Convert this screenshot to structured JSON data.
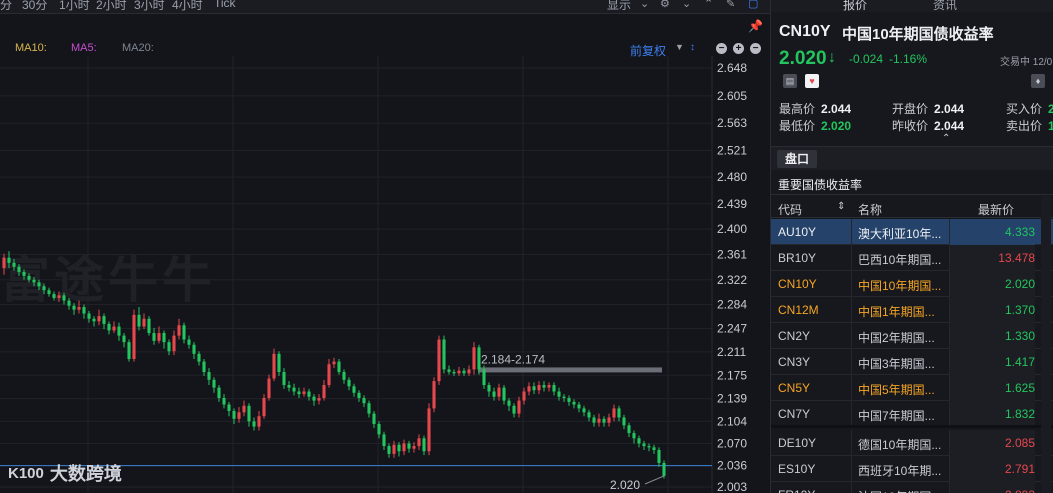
{
  "toolbar": {
    "timeframes": [
      "分",
      "30分",
      "1小时",
      "2小时",
      "3小时",
      "4小时",
      "Tick"
    ],
    "display_label": "显示"
  },
  "indicators": {
    "ma10": "MA10:",
    "ma5": "MA5:",
    "ma20": "MA20:",
    "fuquan_label": "前复权",
    "colors": {
      "ma10": "#d9b64a",
      "ma5": "#c44fd0",
      "ma20": "#7f8691"
    }
  },
  "watermark": "富途牛牛",
  "brand": {
    "logo": "K100",
    "name": "大数跨境"
  },
  "colors": {
    "up": "#e5484d",
    "down": "#22c55e",
    "accent": "#3d7ff0",
    "price_line": "#3b82d6",
    "yellow": "#f5a524"
  },
  "chart_data": {
    "type": "candlestick",
    "y_ticks": [
      "2.648",
      "2.605",
      "2.563",
      "2.521",
      "2.480",
      "2.439",
      "2.400",
      "2.361",
      "2.322",
      "2.284",
      "2.247",
      "2.211",
      "2.175",
      "2.139",
      "2.104",
      "2.070",
      "2.036",
      "2.003"
    ],
    "ylim": [
      2.003,
      2.648
    ],
    "current_price_line": 2.036,
    "range_label": "2.184-2.174",
    "last_price_label": "2.020",
    "candles": [
      [
        2.34,
        2.356,
        2.362,
        2.33
      ],
      [
        2.356,
        2.348,
        2.366,
        2.34
      ],
      [
        2.348,
        2.342,
        2.354,
        2.336
      ],
      [
        2.342,
        2.334,
        2.346,
        2.328
      ],
      [
        2.334,
        2.328,
        2.338,
        2.322
      ],
      [
        2.328,
        2.322,
        2.332,
        2.318
      ],
      [
        2.322,
        2.318,
        2.326,
        2.312
      ],
      [
        2.318,
        2.312,
        2.322,
        2.306
      ],
      [
        2.312,
        2.306,
        2.316,
        2.3
      ],
      [
        2.306,
        2.3,
        2.31,
        2.296
      ],
      [
        2.3,
        2.294,
        2.304,
        2.29
      ],
      [
        2.294,
        2.298,
        2.304,
        2.288
      ],
      [
        2.298,
        2.29,
        2.302,
        2.284
      ],
      [
        2.29,
        2.282,
        2.294,
        2.276
      ],
      [
        2.282,
        2.276,
        2.286,
        2.268
      ],
      [
        2.276,
        2.28,
        2.29,
        2.27
      ],
      [
        2.28,
        2.27,
        2.284,
        2.262
      ],
      [
        2.27,
        2.262,
        2.274,
        2.256
      ],
      [
        2.262,
        2.258,
        2.266,
        2.25
      ],
      [
        2.258,
        2.266,
        2.276,
        2.252
      ],
      [
        2.266,
        2.254,
        2.27,
        2.246
      ],
      [
        2.254,
        2.244,
        2.258,
        2.238
      ],
      [
        2.244,
        2.25,
        2.258,
        2.24
      ],
      [
        2.25,
        2.236,
        2.256,
        2.228
      ],
      [
        2.236,
        2.226,
        2.24,
        2.218
      ],
      [
        2.226,
        2.2,
        2.23,
        2.196
      ],
      [
        2.2,
        2.268,
        2.276,
        2.196
      ],
      [
        2.268,
        2.25,
        2.28,
        2.244
      ],
      [
        2.25,
        2.262,
        2.27,
        2.246
      ],
      [
        2.262,
        2.24,
        2.266,
        2.236
      ],
      [
        2.24,
        2.228,
        2.248,
        2.222
      ],
      [
        2.228,
        2.24,
        2.25,
        2.224
      ],
      [
        2.24,
        2.226,
        2.244,
        2.216
      ],
      [
        2.226,
        2.212,
        2.23,
        2.206
      ],
      [
        2.212,
        2.236,
        2.244,
        2.206
      ],
      [
        2.236,
        2.252,
        2.262,
        2.23
      ],
      [
        2.252,
        2.23,
        2.256,
        2.224
      ],
      [
        2.23,
        2.222,
        2.236,
        2.216
      ],
      [
        2.222,
        2.208,
        2.226,
        2.2
      ],
      [
        2.208,
        2.196,
        2.212,
        2.19
      ],
      [
        2.196,
        2.18,
        2.2,
        2.174
      ],
      [
        2.18,
        2.168,
        2.186,
        2.16
      ],
      [
        2.168,
        2.156,
        2.172,
        2.148
      ],
      [
        2.156,
        2.14,
        2.16,
        2.134
      ],
      [
        2.14,
        2.13,
        2.146,
        2.124
      ],
      [
        2.13,
        2.12,
        2.134,
        2.112
      ],
      [
        2.12,
        2.108,
        2.124,
        2.1
      ],
      [
        2.108,
        2.118,
        2.126,
        2.102
      ],
      [
        2.118,
        2.128,
        2.136,
        2.112
      ],
      [
        2.128,
        2.104,
        2.132,
        2.096
      ],
      [
        2.104,
        2.096,
        2.11,
        2.09
      ],
      [
        2.096,
        2.112,
        2.12,
        2.09
      ],
      [
        2.112,
        2.14,
        2.146,
        2.108
      ],
      [
        2.14,
        2.17,
        2.176,
        2.136
      ],
      [
        2.17,
        2.208,
        2.216,
        2.166
      ],
      [
        2.208,
        2.18,
        2.212,
        2.174
      ],
      [
        2.18,
        2.16,
        2.186,
        2.154
      ],
      [
        2.16,
        2.156,
        2.166,
        2.15
      ],
      [
        2.156,
        2.15,
        2.162,
        2.144
      ],
      [
        2.15,
        2.146,
        2.156,
        2.14
      ],
      [
        2.146,
        2.15,
        2.156,
        2.142
      ],
      [
        2.15,
        2.142,
        2.154,
        2.136
      ],
      [
        2.142,
        2.136,
        2.146,
        2.128
      ],
      [
        2.136,
        2.14,
        2.146,
        2.13
      ],
      [
        2.14,
        2.16,
        2.168,
        2.136
      ],
      [
        2.16,
        2.192,
        2.2,
        2.156
      ],
      [
        2.192,
        2.196,
        2.202,
        2.186
      ],
      [
        2.196,
        2.18,
        2.2,
        2.176
      ],
      [
        2.18,
        2.168,
        2.184,
        2.162
      ],
      [
        2.168,
        2.158,
        2.172,
        2.152
      ],
      [
        2.158,
        2.148,
        2.162,
        2.142
      ],
      [
        2.148,
        2.14,
        2.152,
        2.134
      ],
      [
        2.14,
        2.132,
        2.144,
        2.126
      ],
      [
        2.132,
        2.116,
        2.136,
        2.11
      ],
      [
        2.116,
        2.1,
        2.12,
        2.094
      ],
      [
        2.1,
        2.084,
        2.104,
        2.078
      ],
      [
        2.084,
        2.066,
        2.088,
        2.06
      ],
      [
        2.066,
        2.054,
        2.07,
        2.048
      ],
      [
        2.054,
        2.068,
        2.074,
        2.048
      ],
      [
        2.068,
        2.058,
        2.072,
        2.05
      ],
      [
        2.058,
        2.07,
        2.076,
        2.052
      ],
      [
        2.07,
        2.062,
        2.074,
        2.056
      ],
      [
        2.062,
        2.066,
        2.072,
        2.056
      ],
      [
        2.066,
        2.078,
        2.084,
        2.06
      ],
      [
        2.078,
        2.058,
        2.082,
        2.052
      ],
      [
        2.058,
        2.124,
        2.132,
        2.052
      ],
      [
        2.124,
        2.166,
        2.172,
        2.118
      ],
      [
        2.166,
        2.23,
        2.236,
        2.16
      ],
      [
        2.23,
        2.184,
        2.236,
        2.178
      ],
      [
        2.184,
        2.18,
        2.19,
        2.176
      ],
      [
        2.18,
        2.178,
        2.184,
        2.174
      ],
      [
        2.178,
        2.182,
        2.188,
        2.174
      ],
      [
        2.182,
        2.178,
        2.186,
        2.174
      ],
      [
        2.178,
        2.184,
        2.19,
        2.174
      ],
      [
        2.184,
        2.218,
        2.226,
        2.176
      ],
      [
        2.218,
        2.184,
        2.222,
        2.176
      ],
      [
        2.184,
        2.16,
        2.19,
        2.154
      ],
      [
        2.16,
        2.15,
        2.164,
        2.142
      ],
      [
        2.15,
        2.142,
        2.156,
        2.136
      ],
      [
        2.142,
        2.156,
        2.162,
        2.136
      ],
      [
        2.156,
        2.136,
        2.16,
        2.13
      ],
      [
        2.136,
        2.128,
        2.14,
        2.12
      ],
      [
        2.128,
        2.116,
        2.132,
        2.11
      ],
      [
        2.116,
        2.136,
        2.142,
        2.11
      ],
      [
        2.136,
        2.15,
        2.156,
        2.13
      ],
      [
        2.15,
        2.158,
        2.164,
        2.144
      ],
      [
        2.158,
        2.152,
        2.164,
        2.146
      ],
      [
        2.152,
        2.16,
        2.166,
        2.146
      ],
      [
        2.16,
        2.156,
        2.166,
        2.15
      ],
      [
        2.156,
        2.16,
        2.164,
        2.15
      ],
      [
        2.16,
        2.15,
        2.164,
        2.144
      ],
      [
        2.15,
        2.142,
        2.156,
        2.136
      ],
      [
        2.142,
        2.14,
        2.146,
        2.134
      ],
      [
        2.14,
        2.134,
        2.144,
        2.128
      ],
      [
        2.134,
        2.13,
        2.138,
        2.124
      ],
      [
        2.13,
        2.124,
        2.134,
        2.118
      ],
      [
        2.124,
        2.118,
        2.128,
        2.112
      ],
      [
        2.118,
        2.11,
        2.122,
        2.104
      ],
      [
        2.11,
        2.102,
        2.114,
        2.096
      ],
      [
        2.102,
        2.108,
        2.116,
        2.096
      ],
      [
        2.108,
        2.102,
        2.112,
        2.096
      ],
      [
        2.102,
        2.11,
        2.116,
        2.096
      ],
      [
        2.11,
        2.124,
        2.13,
        2.104
      ],
      [
        2.124,
        2.11,
        2.128,
        2.104
      ],
      [
        2.11,
        2.098,
        2.114,
        2.092
      ],
      [
        2.098,
        2.086,
        2.102,
        2.08
      ],
      [
        2.086,
        2.078,
        2.09,
        2.07
      ],
      [
        2.078,
        2.07,
        2.082,
        2.064
      ],
      [
        2.07,
        2.066,
        2.074,
        2.06
      ],
      [
        2.066,
        2.064,
        2.07,
        2.058
      ],
      [
        2.064,
        2.06,
        2.068,
        2.054
      ],
      [
        2.06,
        2.04,
        2.064,
        2.034
      ],
      [
        2.04,
        2.02,
        2.044,
        2.016
      ]
    ]
  },
  "panel": {
    "tabs": [
      "报价",
      "资讯"
    ],
    "symbol": "CN10Y",
    "name": "中国10年期国债收益率",
    "price": "2.020",
    "change": "-0.024",
    "change_pct": "-1.16%",
    "trade_status": "交易中 12/0",
    "stats": {
      "high_label": "最高价",
      "high": "2.044",
      "open_label": "开盘价",
      "open": "2.044",
      "bid_label": "买入价",
      "bid": "2",
      "low_label": "最低价",
      "low": "2.020",
      "prev_label": "昨收价",
      "prev": "2.044",
      "ask_label": "卖出价",
      "ask": "1"
    },
    "pankou": "盘口",
    "bonds_title": "重要国债收益率",
    "headers": {
      "code": "代码",
      "name": "名称",
      "latest": "最新价"
    },
    "rows": [
      {
        "code": "AU10Y",
        "name": "澳大利亚10年...",
        "price": "4.333",
        "code_color": "#c9ccd3",
        "price_color": "#22c55e",
        "selected": true
      },
      {
        "code": "BR10Y",
        "name": "巴西10年期国...",
        "price": "13.478",
        "code_color": "#c9ccd3",
        "price_color": "#e5484d",
        "selected": false
      },
      {
        "code": "CN10Y",
        "name": "中国10年期国...",
        "price": "2.020",
        "code_color": "#f5a524",
        "price_color": "#22c55e",
        "selected": false
      },
      {
        "code": "CN12M",
        "name": "中国1年期国...",
        "price": "1.370",
        "code_color": "#f5a524",
        "price_color": "#22c55e",
        "selected": false
      },
      {
        "code": "CN2Y",
        "name": "中国2年期国...",
        "price": "1.330",
        "code_color": "#c9ccd3",
        "price_color": "#22c55e",
        "selected": false
      },
      {
        "code": "CN3Y",
        "name": "中国3年期国...",
        "price": "1.417",
        "code_color": "#c9ccd3",
        "price_color": "#22c55e",
        "selected": false
      },
      {
        "code": "CN5Y",
        "name": "中国5年期国...",
        "price": "1.625",
        "code_color": "#f5a524",
        "price_color": "#22c55e",
        "selected": false
      },
      {
        "code": "CN7Y",
        "name": "中国7年期国...",
        "price": "1.832",
        "code_color": "#c9ccd3",
        "price_color": "#22c55e",
        "selected": false
      },
      {
        "code": "DE10Y",
        "name": "德国10年期国...",
        "price": "2.085",
        "code_color": "#c9ccd3",
        "price_color": "#e5484d",
        "selected": false
      },
      {
        "code": "ES10Y",
        "name": "西班牙10年期...",
        "price": "2.791",
        "code_color": "#c9ccd3",
        "price_color": "#e5484d",
        "selected": false
      },
      {
        "code": "FR10Y",
        "name": "法国10年期国...",
        "price": "2.893",
        "code_color": "#c9ccd3",
        "price_color": "#e5484d",
        "selected": false
      }
    ]
  }
}
